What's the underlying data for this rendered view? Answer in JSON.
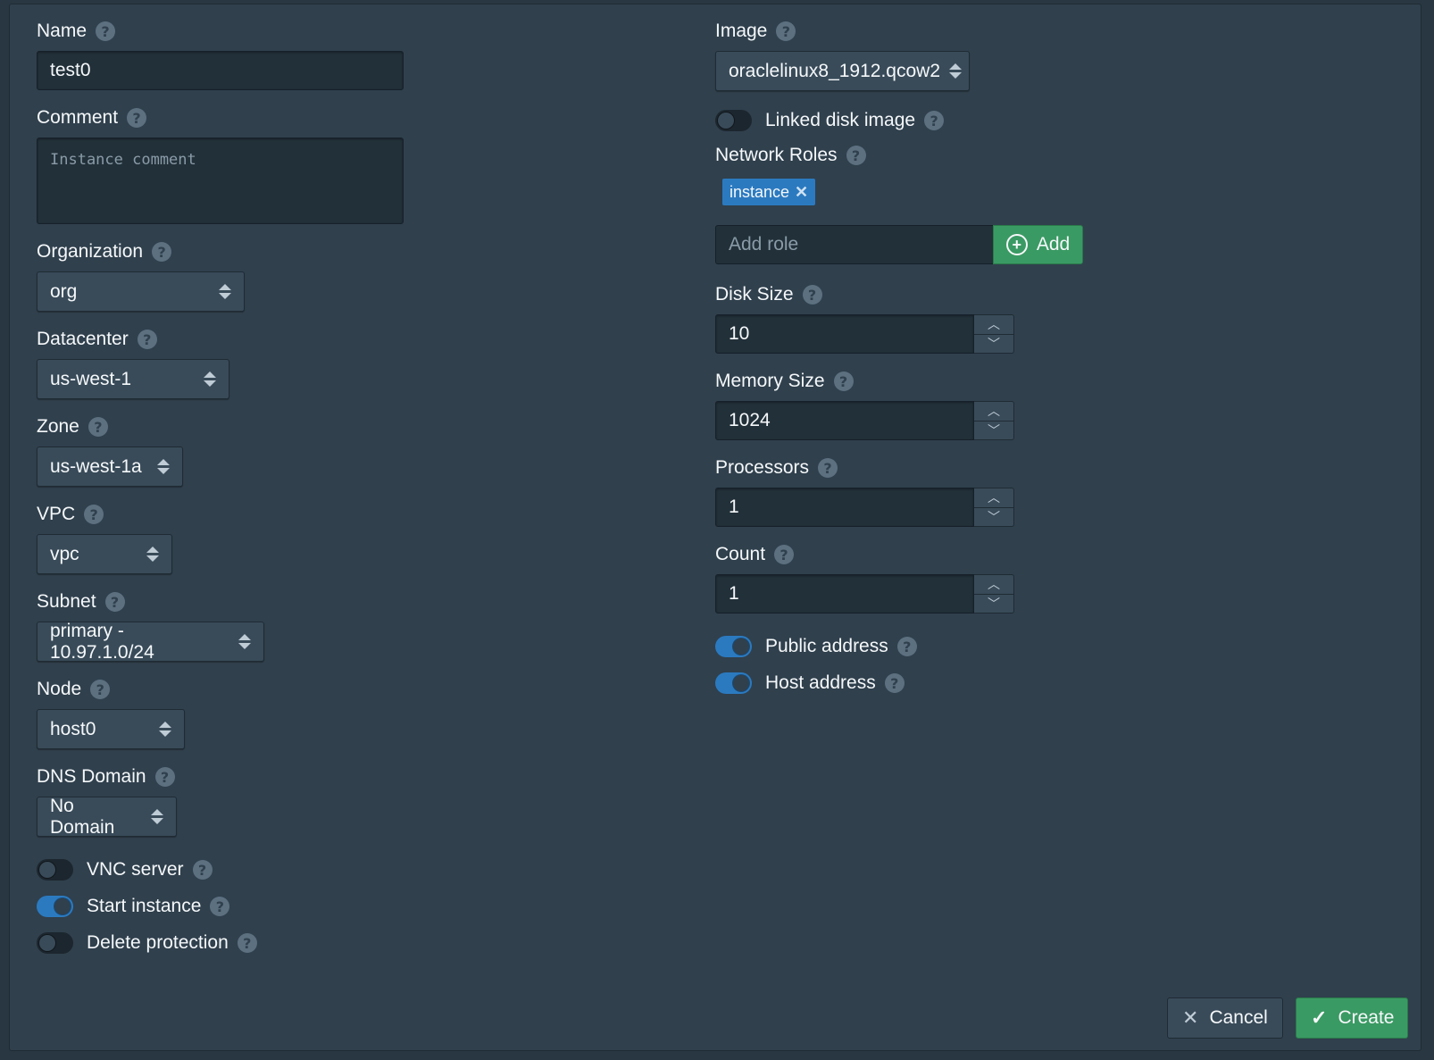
{
  "left": {
    "name": {
      "label": "Name",
      "value": "test0"
    },
    "comment": {
      "label": "Comment",
      "placeholder": "Instance comment"
    },
    "organization": {
      "label": "Organization",
      "value": "org"
    },
    "datacenter": {
      "label": "Datacenter",
      "value": "us-west-1"
    },
    "zone": {
      "label": "Zone",
      "value": "us-west-1a"
    },
    "vpc": {
      "label": "VPC",
      "value": "vpc"
    },
    "subnet": {
      "label": "Subnet",
      "value": "primary - 10.97.1.0/24"
    },
    "node": {
      "label": "Node",
      "value": "host0"
    },
    "dns_domain": {
      "label": "DNS Domain",
      "value": "No Domain"
    },
    "vnc_server": {
      "label": "VNC server",
      "on": false
    },
    "start_instance": {
      "label": "Start instance",
      "on": true
    },
    "delete_protection": {
      "label": "Delete protection",
      "on": false
    }
  },
  "right": {
    "image": {
      "label": "Image",
      "value": "oraclelinux8_1912.qcow2"
    },
    "linked_disk_image": {
      "label": "Linked disk image",
      "on": false
    },
    "network_roles": {
      "label": "Network Roles",
      "tags": [
        "instance"
      ],
      "add_placeholder": "Add role",
      "add_button": "Add"
    },
    "disk_size": {
      "label": "Disk Size",
      "value": "10"
    },
    "memory_size": {
      "label": "Memory Size",
      "value": "1024"
    },
    "processors": {
      "label": "Processors",
      "value": "1"
    },
    "count": {
      "label": "Count",
      "value": "1"
    },
    "public_address": {
      "label": "Public address",
      "on": true
    },
    "host_address": {
      "label": "Host address",
      "on": true
    }
  },
  "help_glyph": "?",
  "footer": {
    "cancel": "Cancel",
    "create": "Create"
  },
  "icons": {
    "help": "question-icon",
    "caret": "caret-updown-icon",
    "tag_remove": "close-icon",
    "add": "plus-circle-icon",
    "cancel": "close-icon",
    "create": "check-icon"
  },
  "colors": {
    "background": "#30404d",
    "primary": "#2b7ac0",
    "success": "#3a9a63"
  }
}
